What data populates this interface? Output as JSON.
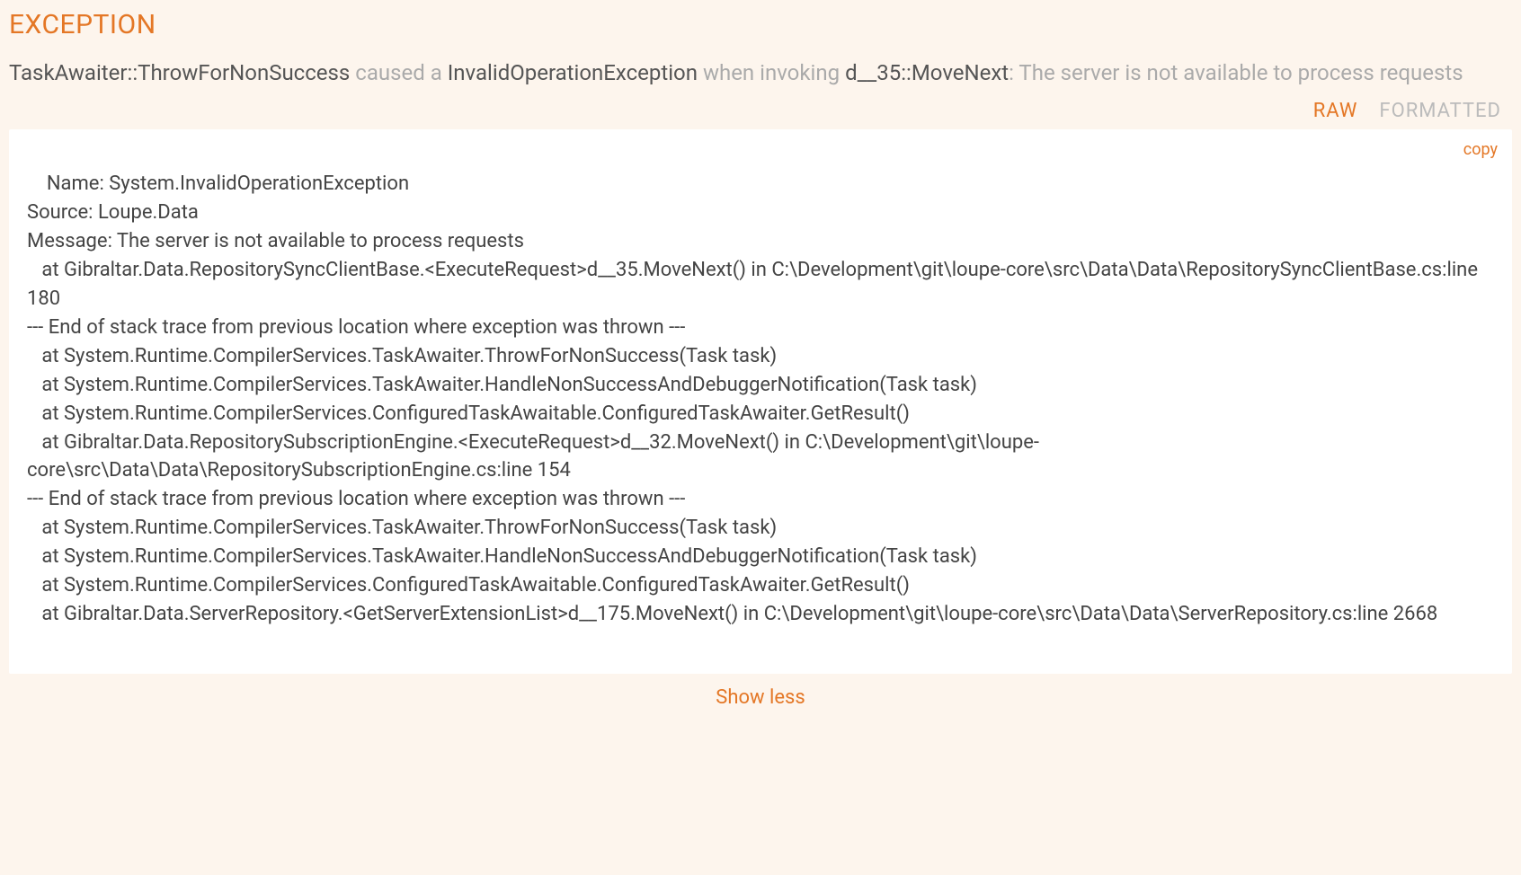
{
  "section_title": "EXCEPTION",
  "summary": {
    "thrower": "TaskAwaiter::ThrowForNonSuccess",
    "caused_text": " caused a ",
    "exception_type": "InvalidOperationException",
    "when_text": " when invoking ",
    "invoked": "d__35::MoveNext",
    "colon": ": ",
    "message": "The server is not available to process requests"
  },
  "tabs": {
    "raw": "RAW",
    "formatted": "FORMATTED"
  },
  "copy_label": "copy",
  "raw_text": "Name: System.InvalidOperationException\nSource: Loupe.Data\nMessage: The server is not available to process requests\n   at Gibraltar.Data.RepositorySyncClientBase.<ExecuteRequest>d__35.MoveNext() in C:\\Development\\git\\loupe-core\\src\\Data\\Data\\RepositorySyncClientBase.cs:line 180\n--- End of stack trace from previous location where exception was thrown ---\n   at System.Runtime.CompilerServices.TaskAwaiter.ThrowForNonSuccess(Task task)\n   at System.Runtime.CompilerServices.TaskAwaiter.HandleNonSuccessAndDebuggerNotification(Task task)\n   at System.Runtime.CompilerServices.ConfiguredTaskAwaitable.ConfiguredTaskAwaiter.GetResult()\n   at Gibraltar.Data.RepositorySubscriptionEngine.<ExecuteRequest>d__32.MoveNext() in C:\\Development\\git\\loupe-core\\src\\Data\\Data\\RepositorySubscriptionEngine.cs:line 154\n--- End of stack trace from previous location where exception was thrown ---\n   at System.Runtime.CompilerServices.TaskAwaiter.ThrowForNonSuccess(Task task)\n   at System.Runtime.CompilerServices.TaskAwaiter.HandleNonSuccessAndDebuggerNotification(Task task)\n   at System.Runtime.CompilerServices.ConfiguredTaskAwaitable.ConfiguredTaskAwaiter.GetResult()\n   at Gibraltar.Data.ServerRepository.<GetServerExtensionList>d__175.MoveNext() in C:\\Development\\git\\loupe-core\\src\\Data\\Data\\ServerRepository.cs:line 2668",
  "show_less": "Show less"
}
